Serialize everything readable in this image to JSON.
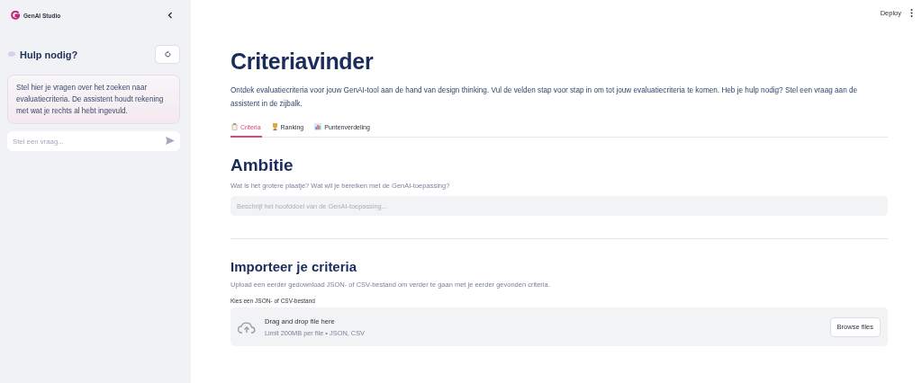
{
  "sidebar": {
    "brand": "GenAI Studio",
    "help_title": "Hulp nodig?",
    "help_text": "Stel hier je vragen over het zoeken naar evaluatiecriteria. De assistent houdt rekening met wat je rechts al hebt ingevuld.",
    "chat_input": {
      "placeholder": "Stel een vraag..."
    }
  },
  "header": {
    "deploy": "Deploy"
  },
  "page": {
    "title": "Criteriavinder",
    "intro": "Ontdek evaluatiecriteria voor jouw GenAI-tool aan de hand van design thinking. Vul de velden stap voor stap in om tot jouw evaluatiecriteria te komen. Heb je hulp nodig? Stel een vraag aan de assistent in de zijbalk.",
    "tabs": [
      {
        "label": "Criteria",
        "kind": "clipboard",
        "selected": true
      },
      {
        "label": "Ranking",
        "kind": "trophy",
        "selected": false
      },
      {
        "label": "Puntenverdeling",
        "kind": "chart",
        "selected": false
      }
    ],
    "ambition": {
      "heading": "Ambitie",
      "caption": "Wat is het grotere plaatje? Wat wil je bereiken met de GenAI-toepassing?",
      "field": {
        "placeholder": "Beschrijf het hoofddoel van de GenAI-toepassing..."
      }
    },
    "import": {
      "heading": "Importeer je criteria",
      "caption": "Upload een eerder gedownload JSON- of CSV-bestand om verder te gaan met je eerder gevonden criteria.",
      "label": "Kies een JSON- of CSV-bestand",
      "drop_title": "Drag and drop file here",
      "drop_hint": "Limit 200MB per file • JSON, CSV",
      "browse": "Browse files"
    }
  }
}
